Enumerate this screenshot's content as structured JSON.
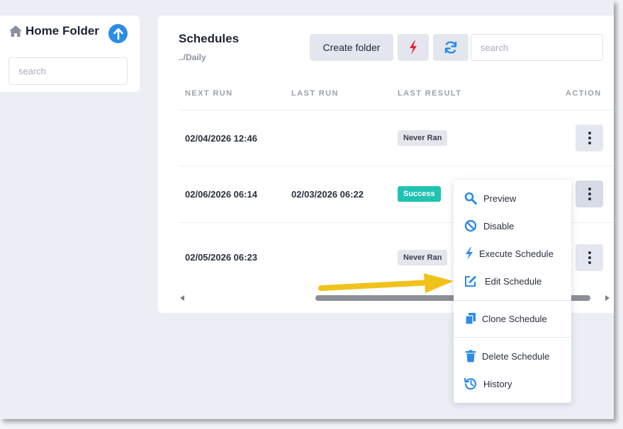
{
  "sidebar": {
    "title": "Home Folder",
    "search_placeholder": "search"
  },
  "main": {
    "title": "Schedules",
    "path": "../Daily",
    "create_folder_label": "Create folder",
    "search_placeholder": "search",
    "columns": [
      "NEXT RUN",
      "LAST RUN",
      "LAST RESULT",
      "ACTION"
    ],
    "rows": [
      {
        "next_run": "02/04/2026 12:46",
        "last_run": "",
        "last_result": "Never Ran"
      },
      {
        "next_run": "02/06/2026 06:14",
        "last_run": "02/03/2026 06:22",
        "last_result": "Success"
      },
      {
        "next_run": "02/05/2026 06:23",
        "last_run": "",
        "last_result": "Never Ran"
      }
    ]
  },
  "context_menu": {
    "items": [
      {
        "label": "Preview",
        "icon": "search-icon"
      },
      {
        "label": "Disable",
        "icon": "ban-icon"
      },
      {
        "label": "Execute Schedule",
        "icon": "bolt-icon"
      },
      {
        "label": "Edit Schedule",
        "icon": "edit-icon"
      },
      {
        "label": "Clone Schedule",
        "icon": "copy-icon"
      },
      {
        "label": "Delete Schedule",
        "icon": "trash-icon"
      },
      {
        "label": "History",
        "icon": "history-icon"
      }
    ]
  },
  "colors": {
    "accent": "#2b8be8",
    "success": "#1fc3b1",
    "bolt": "#e8202a",
    "annotation_arrow": "#f0c21b"
  }
}
